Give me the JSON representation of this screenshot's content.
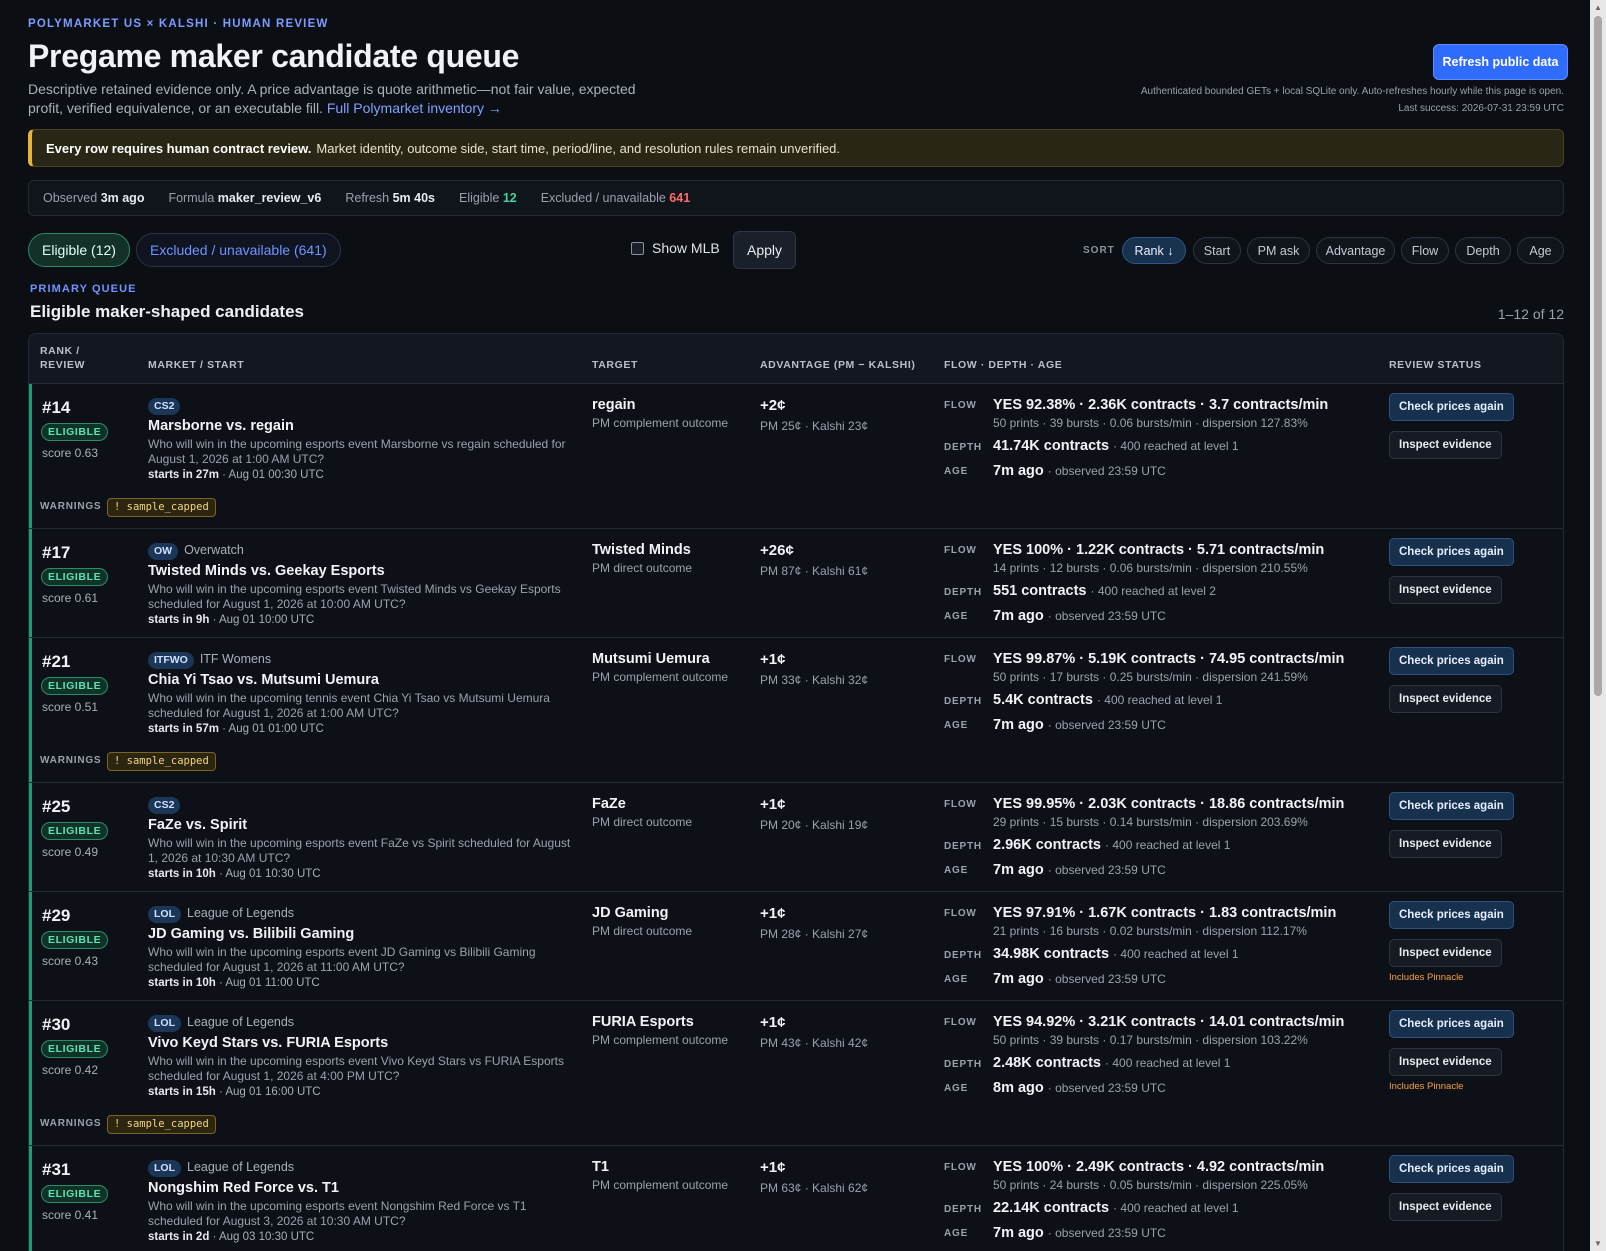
{
  "header": {
    "eyebrow": "POLYMARKET US × KALSHI · HUMAN REVIEW",
    "title": "Pregame maker candidate queue",
    "desc": "Descriptive retained evidence only. A price advantage is quote arithmetic—not fair value, expected profit, verified equivalence, or an executable fill.",
    "link": "Full Polymarket inventory →",
    "refresh": "Refresh public data",
    "meta1": "Authenticated bounded GETs + local SQLite only. Auto-refreshes hourly while this page is open.",
    "meta2": "Last success: 2026-07-31 23:59 UTC"
  },
  "banner": {
    "bold": "Every row requires human contract review.",
    "text": "Market identity, outcome side, start time, period/line, and resolution rules remain unverified."
  },
  "stats": {
    "observed_l": "Observed",
    "observed": "3m ago",
    "formula_l": "Formula",
    "formula": "maker_review_v6",
    "refresh_l": "Refresh",
    "refresh": "5m 40s",
    "eligible_l": "Eligible",
    "eligible": "12",
    "excluded_l": "Excluded / unavailable",
    "excluded": "641"
  },
  "tabs": {
    "eligible": "Eligible (12)",
    "excluded": "Excluded / unavailable (641)"
  },
  "controls": {
    "mlb": "Show MLB",
    "apply": "Apply",
    "sort_label": "SORT",
    "sorts": [
      "Rank ↓",
      "Start",
      "PM ask",
      "Advantage",
      "Flow",
      "Depth",
      "Age"
    ]
  },
  "queue": {
    "eyebrow": "PRIMARY QUEUE",
    "title": "Eligible maker-shaped candidates",
    "count": "1–12 of 12"
  },
  "columns": {
    "rank": "RANK /",
    "review": "REVIEW",
    "market": "MARKET / START",
    "target": "TARGET",
    "advantage": "ADVANTAGE (PM − KALSHI)",
    "flow": "FLOW · DEPTH · AGE",
    "status": "REVIEW STATUS"
  },
  "labels": {
    "flow": "FLOW",
    "depth": "DEPTH",
    "age": "AGE",
    "check": "Check prices again",
    "inspect": "Inspect evidence",
    "warnings": "WARNINGS"
  },
  "rows": [
    {
      "rank": "#14",
      "badge": "ELIGIBLE",
      "score": "score 0.63",
      "chip": "CS2",
      "league": "",
      "title": "Marsborne vs. regain",
      "q": "Who will win in the upcoming esports event Marsborne vs regain scheduled for August 1, 2026 at 1:00 AM UTC?",
      "starts": "starts in 27m",
      "date": "· Aug 01 00:30 UTC",
      "target": "regain",
      "target_sub": "PM complement outcome",
      "adv": "+2¢",
      "adv_sub": "PM 25¢ · Kalshi 23¢",
      "flow": "YES 92.38% · 2.36K contracts · 3.7 contracts/min",
      "flow_sub": "50 prints · 39 bursts · 0.06 bursts/min · dispersion 127.83%",
      "depth": "41.74K contracts",
      "depth_sub": "· 400 reached at level 1",
      "age": "7m ago",
      "age_sub": "· observed 23:59 UTC",
      "note": "",
      "warning": "! sample_capped"
    },
    {
      "rank": "#17",
      "badge": "ELIGIBLE",
      "score": "score 0.61",
      "chip": "OW",
      "league": "Overwatch",
      "title": "Twisted Minds vs. Geekay Esports",
      "q": "Who will win in the upcoming esports event Twisted Minds vs Geekay Esports scheduled for August 1, 2026 at 10:00 AM UTC?",
      "starts": "starts in 9h",
      "date": "· Aug 01 10:00 UTC",
      "target": "Twisted Minds",
      "target_sub": "PM direct outcome",
      "adv": "+26¢",
      "adv_sub": "PM 87¢ · Kalshi 61¢",
      "flow": "YES 100% · 1.22K contracts · 5.71 contracts/min",
      "flow_sub": "14 prints · 12 bursts · 0.06 bursts/min · dispersion 210.55%",
      "depth": "551 contracts",
      "depth_sub": "· 400 reached at level 2",
      "age": "7m ago",
      "age_sub": "· observed 23:59 UTC",
      "note": "",
      "warning": ""
    },
    {
      "rank": "#21",
      "badge": "ELIGIBLE",
      "score": "score 0.51",
      "chip": "ITFWO",
      "league": "ITF Womens",
      "title": "Chia Yi Tsao vs. Mutsumi Uemura",
      "q": "Who will win in the upcoming tennis event Chia Yi Tsao vs Mutsumi Uemura scheduled for August 1, 2026 at 1:00 AM UTC?",
      "starts": "starts in 57m",
      "date": "· Aug 01 01:00 UTC",
      "target": "Mutsumi Uemura",
      "target_sub": "PM complement outcome",
      "adv": "+1¢",
      "adv_sub": "PM 33¢ · Kalshi 32¢",
      "flow": "YES 99.87% · 5.19K contracts · 74.95 contracts/min",
      "flow_sub": "50 prints · 17 bursts · 0.25 bursts/min · dispersion 241.59%",
      "depth": "5.4K contracts",
      "depth_sub": "· 400 reached at level 1",
      "age": "7m ago",
      "age_sub": "· observed 23:59 UTC",
      "note": "",
      "warning": "! sample_capped"
    },
    {
      "rank": "#25",
      "badge": "ELIGIBLE",
      "score": "score 0.49",
      "chip": "CS2",
      "league": "",
      "title": "FaZe vs. Spirit",
      "q": "Who will win in the upcoming esports event FaZe vs Spirit scheduled for August 1, 2026 at 10:30 AM UTC?",
      "starts": "starts in 10h",
      "date": "· Aug 01 10:30 UTC",
      "target": "FaZe",
      "target_sub": "PM direct outcome",
      "adv": "+1¢",
      "adv_sub": "PM 20¢ · Kalshi 19¢",
      "flow": "YES 99.95% · 2.03K contracts · 18.86 contracts/min",
      "flow_sub": "29 prints · 15 bursts · 0.14 bursts/min · dispersion 203.69%",
      "depth": "2.96K contracts",
      "depth_sub": "· 400 reached at level 1",
      "age": "7m ago",
      "age_sub": "· observed 23:59 UTC",
      "note": "",
      "warning": ""
    },
    {
      "rank": "#29",
      "badge": "ELIGIBLE",
      "score": "score 0.43",
      "chip": "LOL",
      "league": "League of Legends",
      "title": "JD Gaming vs. Bilibili Gaming",
      "q": "Who will win in the upcoming esports event JD Gaming vs Bilibili Gaming scheduled for August 1, 2026 at 11:00 AM UTC?",
      "starts": "starts in 10h",
      "date": "· Aug 01 11:00 UTC",
      "target": "JD Gaming",
      "target_sub": "PM direct outcome",
      "adv": "+1¢",
      "adv_sub": "PM 28¢ · Kalshi 27¢",
      "flow": "YES 97.91% · 1.67K contracts · 1.83 contracts/min",
      "flow_sub": "21 prints · 16 bursts · 0.02 bursts/min · dispersion 112.17%",
      "depth": "34.98K contracts",
      "depth_sub": "· 400 reached at level 1",
      "age": "7m ago",
      "age_sub": "· observed 23:59 UTC",
      "note": "Includes Pinnacle",
      "warning": ""
    },
    {
      "rank": "#30",
      "badge": "ELIGIBLE",
      "score": "score 0.42",
      "chip": "LOL",
      "league": "League of Legends",
      "title": "Vivo Keyd Stars vs. FURIA Esports",
      "q": "Who will win in the upcoming esports event Vivo Keyd Stars vs FURIA Esports scheduled for August 1, 2026 at 4:00 PM UTC?",
      "starts": "starts in 15h",
      "date": "· Aug 01 16:00 UTC",
      "target": "FURIA Esports",
      "target_sub": "PM complement outcome",
      "adv": "+1¢",
      "adv_sub": "PM 43¢ · Kalshi 42¢",
      "flow": "YES 94.92% · 3.21K contracts · 14.01 contracts/min",
      "flow_sub": "50 prints · 39 bursts · 0.17 bursts/min · dispersion 103.22%",
      "depth": "2.48K contracts",
      "depth_sub": "· 400 reached at level 1",
      "age": "8m ago",
      "age_sub": "· observed 23:59 UTC",
      "note": "Includes Pinnacle",
      "warning": "! sample_capped"
    },
    {
      "rank": "#31",
      "badge": "ELIGIBLE",
      "score": "score 0.41",
      "chip": "LOL",
      "league": "League of Legends",
      "title": "Nongshim Red Force vs. T1",
      "q": "Who will win in the upcoming esports event Nongshim Red Force vs T1 scheduled for August 3, 2026 at 10:30 AM UTC?",
      "starts": "starts in 2d",
      "date": "· Aug 03 10:30 UTC",
      "target": "T1",
      "target_sub": "PM complement outcome",
      "adv": "+1¢",
      "adv_sub": "PM 63¢ · Kalshi 62¢",
      "flow": "YES 100% · 2.49K contracts · 4.92 contracts/min",
      "flow_sub": "50 prints · 24 bursts · 0.05 bursts/min · dispersion 225.05%",
      "depth": "22.14K contracts",
      "depth_sub": "· 400 reached at level 1",
      "age": "7m ago",
      "age_sub": "· observed 23:59 UTC",
      "note": "",
      "warning": ""
    }
  ]
}
